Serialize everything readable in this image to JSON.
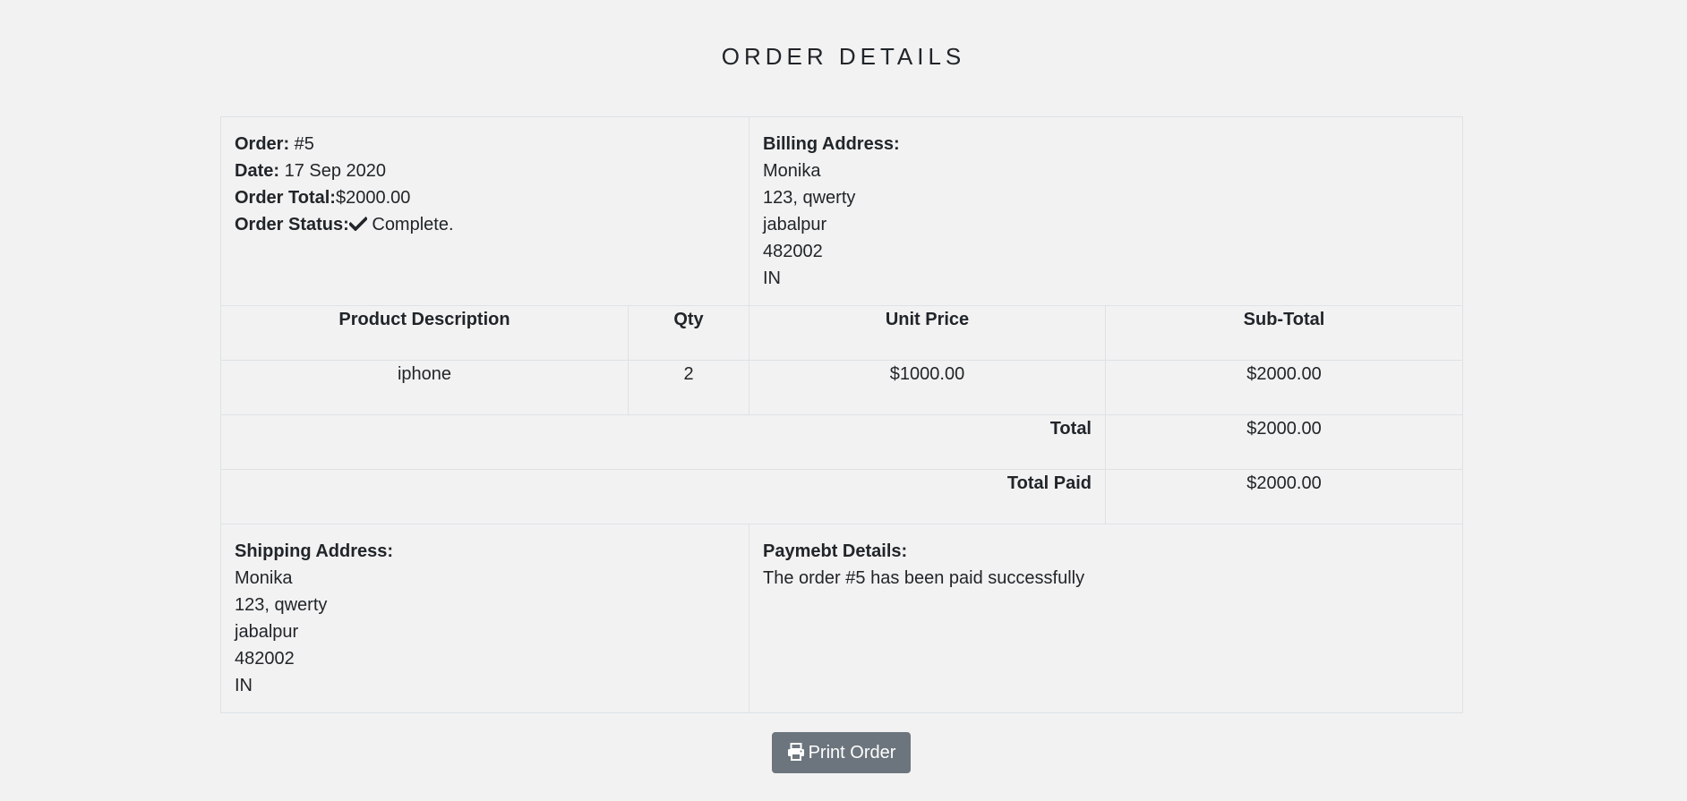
{
  "page": {
    "title": "ORDER DETAILS"
  },
  "order_info": {
    "order_label": "Order:",
    "order_value": " #5",
    "date_label": "Date:",
    "date_value": " 17 Sep 2020",
    "total_label": "Order Total:",
    "total_value": "$2000.00",
    "status_label": "Order Status:",
    "status_icon": "check-icon",
    "status_value": " Complete."
  },
  "billing": {
    "label": "Billing Address:",
    "name": "Monika",
    "line1": "123, qwerty",
    "city": "jabalpur",
    "zip": "482002",
    "country": "IN"
  },
  "items_table": {
    "headers": [
      "Product Description",
      "Qty",
      "Unit Price",
      "Sub-Total"
    ],
    "rows": [
      {
        "description": "iphone",
        "qty": "2",
        "unit_price": "$1000.00",
        "subtotal": "$2000.00"
      }
    ],
    "total_label": "Total",
    "total_value": "$2000.00",
    "paid_label": "Total Paid",
    "paid_value": "$2000.00"
  },
  "shipping": {
    "label": "Shipping Address:",
    "name": "Monika",
    "line1": "123, qwerty",
    "city": "jabalpur",
    "zip": "482002",
    "country": "IN"
  },
  "payment": {
    "label": "Paymebt Details:",
    "message": "The order #5 has been paid successfully"
  },
  "actions": {
    "print_icon": "printer-icon",
    "print_label": "Print Order"
  },
  "colors": {
    "background": "#f2f2f2",
    "text": "#212529",
    "border": "#dee2e6",
    "button": "#6c757d"
  }
}
